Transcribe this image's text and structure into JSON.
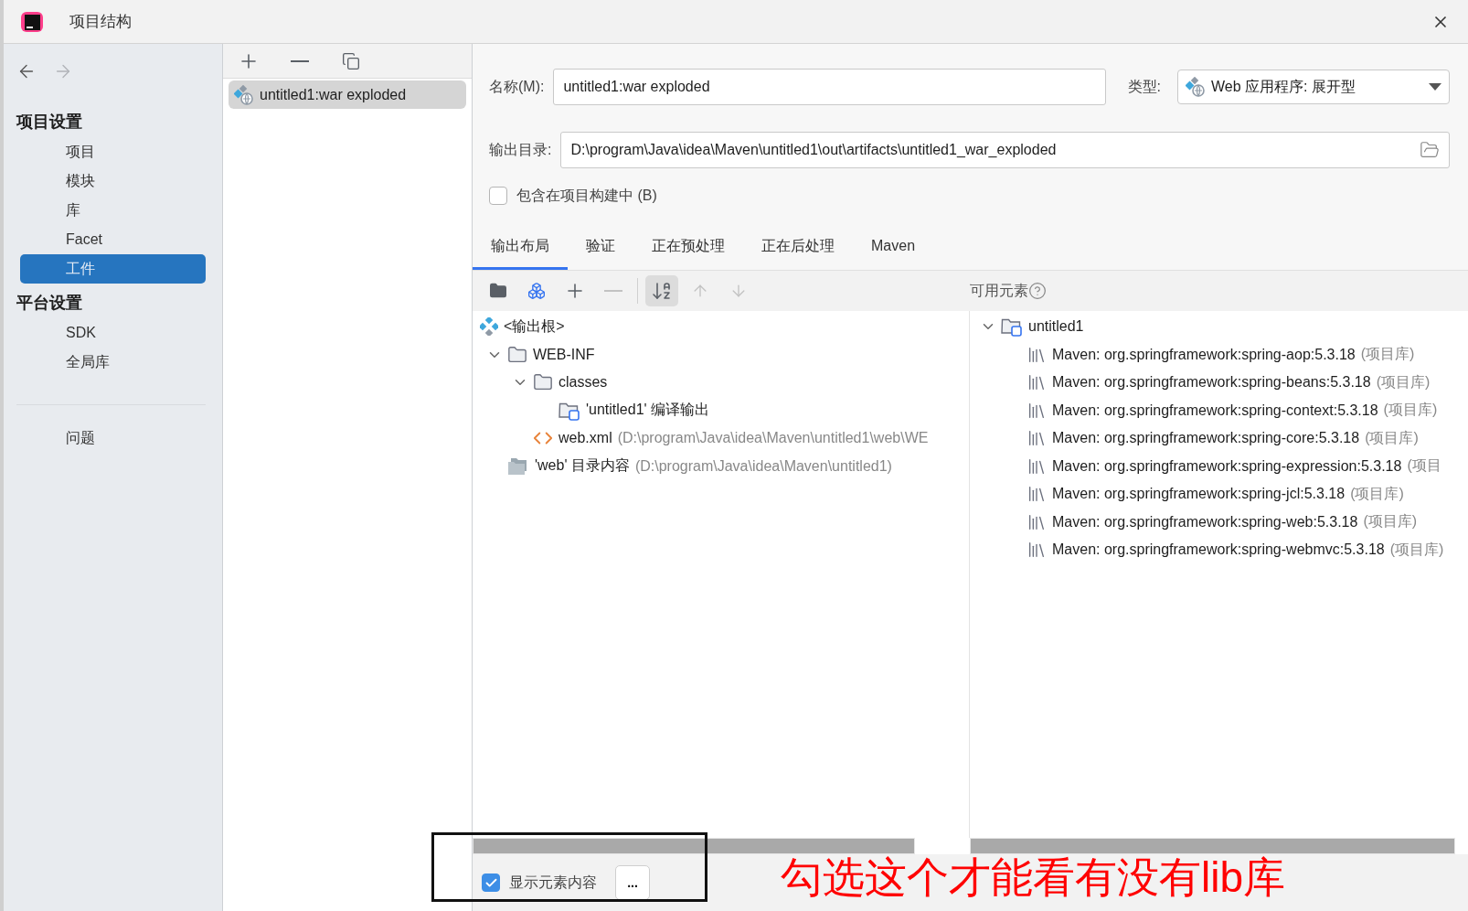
{
  "window": {
    "title": "项目结构"
  },
  "nav": [
    {
      "kind": "back",
      "disabled": false
    },
    {
      "kind": "forward",
      "disabled": true
    }
  ],
  "sidebar": {
    "sections": [
      {
        "title": "项目设置",
        "items": [
          {
            "label": "项目",
            "selected": false
          },
          {
            "label": "模块",
            "selected": false
          },
          {
            "label": "库",
            "selected": false
          },
          {
            "label": "Facet",
            "selected": false
          },
          {
            "label": "工件",
            "selected": true
          }
        ]
      },
      {
        "title": "平台设置",
        "items": [
          {
            "label": "SDK",
            "selected": false
          },
          {
            "label": "全局库",
            "selected": false
          }
        ]
      }
    ],
    "footer_items": [
      {
        "label": "问题",
        "selected": false
      }
    ]
  },
  "artifact_toolbar": [
    {
      "kind": "add"
    },
    {
      "kind": "remove"
    },
    {
      "kind": "copy"
    }
  ],
  "artifacts": [
    {
      "label": "untitled1:war exploded",
      "selected": true
    }
  ],
  "form": {
    "name_label": "名称(M):",
    "name_value": "untitled1:war exploded",
    "type_label": "类型:",
    "type_value": "Web 应用程序: 展开型",
    "output_label": "输出目录:",
    "output_value": "D:\\program\\Java\\idea\\Maven\\untitled1\\out\\artifacts\\untitled1_war_exploded",
    "include_label": "包含在项目构建中 (B)",
    "include_checked": false
  },
  "tabs": [
    {
      "label": "输出布局",
      "selected": true
    },
    {
      "label": "验证",
      "selected": false
    },
    {
      "label": "正在预处理",
      "selected": false
    },
    {
      "label": "正在后处理",
      "selected": false
    },
    {
      "label": "Maven",
      "selected": false
    }
  ],
  "layout_toolbar": [
    {
      "kind": "new_folder",
      "disabled": false,
      "on": false
    },
    {
      "kind": "module",
      "disabled": false,
      "on": false
    },
    {
      "kind": "add",
      "disabled": false,
      "on": false
    },
    {
      "kind": "remove",
      "disabled": true,
      "on": false
    },
    {
      "kind": "separator"
    },
    {
      "kind": "sort",
      "disabled": false,
      "on": true
    },
    {
      "kind": "up",
      "disabled": true,
      "on": false
    },
    {
      "kind": "down",
      "disabled": true,
      "on": false
    }
  ],
  "available_label": "可用元素",
  "layout_tree": [
    {
      "kind": "root",
      "label": "<输出根>"
    },
    {
      "kind": "folder",
      "label": "WEB-INF",
      "expanded": true,
      "children": [
        {
          "kind": "folder",
          "label": "classes",
          "expanded": true,
          "children": [
            {
              "kind": "module_output",
              "label": "'untitled1' 编译输出"
            }
          ]
        },
        {
          "kind": "xml",
          "label": "web.xml",
          "detail": "(D:\\program\\Java\\idea\\Maven\\untitled1\\web\\WE"
        }
      ]
    },
    {
      "kind": "dir_content",
      "label": "'web' 目录内容",
      "detail": "(D:\\program\\Java\\idea\\Maven\\untitled1)"
    }
  ],
  "available_tree": [
    {
      "kind": "module",
      "label": "untitled1",
      "expanded": true,
      "children": [
        {
          "kind": "library",
          "label": "Maven: org.springframework:spring-aop:5.3.18",
          "detail": "(项目库)"
        },
        {
          "kind": "library",
          "label": "Maven: org.springframework:spring-beans:5.3.18",
          "detail": "(项目库)"
        },
        {
          "kind": "library",
          "label": "Maven: org.springframework:spring-context:5.3.18",
          "detail": "(项目库)"
        },
        {
          "kind": "library",
          "label": "Maven: org.springframework:spring-core:5.3.18",
          "detail": "(项目库)"
        },
        {
          "kind": "library",
          "label": "Maven: org.springframework:spring-expression:5.3.18",
          "detail": "(项目"
        },
        {
          "kind": "library",
          "label": "Maven: org.springframework:spring-jcl:5.3.18",
          "detail": "(项目库)"
        },
        {
          "kind": "library",
          "label": "Maven: org.springframework:spring-web:5.3.18",
          "detail": "(项目库)"
        },
        {
          "kind": "library",
          "label": "Maven: org.springframework:spring-webmvc:5.3.18",
          "detail": "(项目库)"
        }
      ]
    }
  ],
  "bottom": {
    "show_content_label": "显示元素内容",
    "show_content_checked": true,
    "more_button": "..."
  },
  "annotation": {
    "text": "勾选这个才能看有没有lib库",
    "boxed": true
  }
}
